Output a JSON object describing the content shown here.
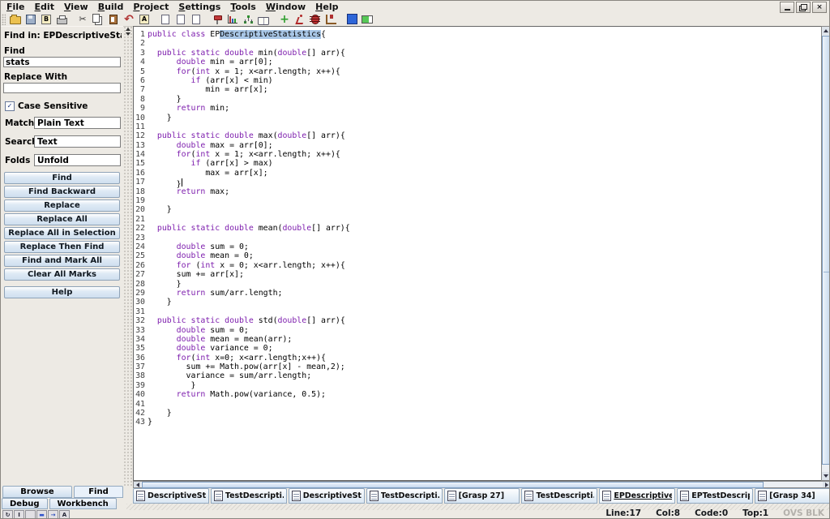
{
  "menubar": {
    "items": [
      "File",
      "Edit",
      "View",
      "Build",
      "Project",
      "Settings",
      "Tools",
      "Window",
      "Help"
    ]
  },
  "window_controls": {
    "minimize": "minimize",
    "restore": "restore",
    "close": "close",
    "close_glyph": "×"
  },
  "toolbar": {
    "icons": [
      {
        "name": "open-file-icon",
        "shape": "folder"
      },
      {
        "name": "save-icon",
        "shape": "floppy"
      },
      {
        "name": "bytecode-icon",
        "glyph": "B",
        "boxed": true
      },
      {
        "name": "print-icon",
        "shape": "printer"
      },
      {
        "name": "cut-icon",
        "glyph": "✂",
        "color": "#333333",
        "gap": true
      },
      {
        "name": "copy-icon",
        "shape": "copy"
      },
      {
        "name": "paste-icon",
        "shape": "paste"
      },
      {
        "name": "undo-icon",
        "glyph": "↶",
        "color": "#b03434",
        "big": true
      },
      {
        "name": "find-replace-icon",
        "glyph": "A",
        "boxed": true
      },
      {
        "name": "new-view-icon",
        "shape": "page",
        "gap": true
      },
      {
        "name": "new-file-icon",
        "shape": "page"
      },
      {
        "name": "blank-file-icon",
        "shape": "page"
      },
      {
        "name": "pin-window-icon",
        "shape": "pin",
        "gap": true
      },
      {
        "name": "statistics-icon",
        "shape": "chart"
      },
      {
        "name": "hierarchy-icon",
        "shape": "tree"
      },
      {
        "name": "documentation-icon",
        "shape": "book"
      },
      {
        "name": "compile-icon",
        "glyph": "+",
        "color": "#2f9e2f",
        "big": true,
        "gap": true
      },
      {
        "name": "run-icon",
        "shape": "runner"
      },
      {
        "name": "debug-icon",
        "shape": "bug"
      },
      {
        "name": "workbench-icon",
        "shape": "bench"
      },
      {
        "name": "csd-window-icon",
        "shape": "bluesq",
        "gap": true
      },
      {
        "name": "progress-icon",
        "shape": "greenbar"
      }
    ]
  },
  "find_panel": {
    "header": "Find in: EPDescriptiveStatistic",
    "find_label": "Find",
    "find_value": "stats",
    "replace_label": "Replace With",
    "replace_value": "",
    "case_sensitive_label": "Case Sensitive",
    "case_sensitive_checked": true,
    "check_glyph": "✓",
    "match_label": "Match",
    "match_value": "Plain Text",
    "search_label": "Search",
    "search_value": "Text",
    "folds_label": "Folds",
    "folds_value": "Unfold",
    "buttons": [
      "Find",
      "Find Backward",
      "Replace",
      "Replace All",
      "Replace All in Selection",
      "Replace Then Find",
      "Find and Mark All",
      "Clear All Marks"
    ],
    "help_button": "Help"
  },
  "editor": {
    "lines": [
      {
        "n": 1,
        "s": [
          [
            "k",
            "public class "
          ],
          [
            "p",
            "EP"
          ],
          [
            "sel",
            "DescriptiveStatistics"
          ],
          [
            "p",
            "{"
          ]
        ]
      },
      {
        "n": 2,
        "s": []
      },
      {
        "n": 3,
        "s": [
          [
            "p",
            "  "
          ],
          [
            "k",
            "public static double"
          ],
          [
            "p",
            " min("
          ],
          [
            "k",
            "double"
          ],
          [
            "p",
            "[] arr){"
          ]
        ]
      },
      {
        "n": 4,
        "s": [
          [
            "p",
            "      "
          ],
          [
            "k",
            "double"
          ],
          [
            "p",
            " min = arr[0];"
          ]
        ]
      },
      {
        "n": 5,
        "s": [
          [
            "p",
            "      "
          ],
          [
            "k",
            "for"
          ],
          [
            "p",
            "("
          ],
          [
            "k",
            "int"
          ],
          [
            "p",
            " x = 1; x<arr.length; x++){"
          ]
        ]
      },
      {
        "n": 6,
        "s": [
          [
            "p",
            "         "
          ],
          [
            "k",
            "if"
          ],
          [
            "p",
            " (arr[x] < min)"
          ]
        ]
      },
      {
        "n": 7,
        "s": [
          [
            "p",
            "            min = arr[x];"
          ]
        ]
      },
      {
        "n": 8,
        "s": [
          [
            "p",
            "      }"
          ]
        ]
      },
      {
        "n": 9,
        "s": [
          [
            "p",
            "      "
          ],
          [
            "k",
            "return"
          ],
          [
            "p",
            " min;"
          ]
        ]
      },
      {
        "n": 10,
        "s": [
          [
            "p",
            "    }"
          ]
        ]
      },
      {
        "n": 11,
        "s": []
      },
      {
        "n": 12,
        "s": [
          [
            "p",
            "  "
          ],
          [
            "k",
            "public static double"
          ],
          [
            "p",
            " max("
          ],
          [
            "k",
            "double"
          ],
          [
            "p",
            "[] arr){"
          ]
        ]
      },
      {
        "n": 13,
        "s": [
          [
            "p",
            "      "
          ],
          [
            "k",
            "double"
          ],
          [
            "p",
            " max = arr[0];"
          ]
        ]
      },
      {
        "n": 14,
        "s": [
          [
            "p",
            "      "
          ],
          [
            "k",
            "for"
          ],
          [
            "p",
            "("
          ],
          [
            "k",
            "int"
          ],
          [
            "p",
            " x = 1; x<arr.length; x++){"
          ]
        ]
      },
      {
        "n": 15,
        "s": [
          [
            "p",
            "         "
          ],
          [
            "k",
            "if"
          ],
          [
            "p",
            " (arr[x] > max)"
          ]
        ]
      },
      {
        "n": 16,
        "s": [
          [
            "p",
            "            max = arr[x];"
          ]
        ]
      },
      {
        "n": 17,
        "s": [
          [
            "p",
            "      }"
          ]
        ],
        "caret": true
      },
      {
        "n": 18,
        "s": [
          [
            "p",
            "      "
          ],
          [
            "k",
            "return"
          ],
          [
            "p",
            " max;"
          ]
        ]
      },
      {
        "n": 19,
        "s": []
      },
      {
        "n": 20,
        "s": [
          [
            "p",
            "    }"
          ]
        ]
      },
      {
        "n": 21,
        "s": []
      },
      {
        "n": 22,
        "s": [
          [
            "p",
            "  "
          ],
          [
            "k",
            "public static double"
          ],
          [
            "p",
            " mean("
          ],
          [
            "k",
            "double"
          ],
          [
            "p",
            "[] arr){"
          ]
        ]
      },
      {
        "n": 23,
        "s": []
      },
      {
        "n": 24,
        "s": [
          [
            "p",
            "      "
          ],
          [
            "k",
            "double"
          ],
          [
            "p",
            " sum = 0;"
          ]
        ]
      },
      {
        "n": 25,
        "s": [
          [
            "p",
            "      "
          ],
          [
            "k",
            "double"
          ],
          [
            "p",
            " mean = 0;"
          ]
        ]
      },
      {
        "n": 26,
        "s": [
          [
            "p",
            "      "
          ],
          [
            "k",
            "for"
          ],
          [
            "p",
            " ("
          ],
          [
            "k",
            "int"
          ],
          [
            "p",
            " x = 0; x<arr.length; x++){"
          ]
        ]
      },
      {
        "n": 27,
        "s": [
          [
            "p",
            "      sum += arr[x];"
          ]
        ]
      },
      {
        "n": 28,
        "s": [
          [
            "p",
            "      }"
          ]
        ]
      },
      {
        "n": 29,
        "s": [
          [
            "p",
            "      "
          ],
          [
            "k",
            "return"
          ],
          [
            "p",
            " sum/arr.length;"
          ]
        ]
      },
      {
        "n": 30,
        "s": [
          [
            "p",
            "    }"
          ]
        ]
      },
      {
        "n": 31,
        "s": []
      },
      {
        "n": 32,
        "s": [
          [
            "p",
            "  "
          ],
          [
            "k",
            "public static double"
          ],
          [
            "p",
            " std("
          ],
          [
            "k",
            "double"
          ],
          [
            "p",
            "[] arr){"
          ]
        ]
      },
      {
        "n": 33,
        "s": [
          [
            "p",
            "      "
          ],
          [
            "k",
            "double"
          ],
          [
            "p",
            " sum = 0;"
          ]
        ]
      },
      {
        "n": 34,
        "s": [
          [
            "p",
            "      "
          ],
          [
            "k",
            "double"
          ],
          [
            "p",
            " mean = mean(arr);"
          ]
        ]
      },
      {
        "n": 35,
        "s": [
          [
            "p",
            "      "
          ],
          [
            "k",
            "double"
          ],
          [
            "p",
            " variance = 0;"
          ]
        ]
      },
      {
        "n": 36,
        "s": [
          [
            "p",
            "      "
          ],
          [
            "k",
            "for"
          ],
          [
            "p",
            "("
          ],
          [
            "k",
            "int"
          ],
          [
            "p",
            " x=0; x<arr.length;x++){"
          ]
        ]
      },
      {
        "n": 37,
        "s": [
          [
            "p",
            "        sum += Math.pow(arr[x] - mean,2);"
          ]
        ]
      },
      {
        "n": 38,
        "s": [
          [
            "p",
            "        variance = sum/arr.length;"
          ]
        ]
      },
      {
        "n": 39,
        "s": [
          [
            "p",
            "         }"
          ]
        ]
      },
      {
        "n": 40,
        "s": [
          [
            "p",
            "      "
          ],
          [
            "k",
            "return"
          ],
          [
            "p",
            " Math.pow(variance, 0.5);"
          ]
        ]
      },
      {
        "n": 41,
        "s": []
      },
      {
        "n": 42,
        "s": [
          [
            "p",
            "    }"
          ]
        ]
      },
      {
        "n": 43,
        "s": [
          [
            "p",
            "}"
          ]
        ]
      }
    ],
    "colors": {
      "keyword": "#7e1fae",
      "selection": "#a9c7e7",
      "text": "#000000",
      "background": "#ffffff"
    }
  },
  "file_tabs": [
    {
      "label": "DescriptiveSta...",
      "active": false
    },
    {
      "label": "TestDescripti...",
      "active": false
    },
    {
      "label": "DescriptiveSta...",
      "active": false
    },
    {
      "label": "TestDescripti...",
      "active": false
    },
    {
      "label": "[Grasp 27]",
      "active": false
    },
    {
      "label": "TestDescripti...",
      "active": false
    },
    {
      "label": "EPDescriptive...",
      "active": true
    },
    {
      "label": "EPTestDescrip...",
      "active": false
    },
    {
      "label": "[Grasp 34]",
      "active": false
    }
  ],
  "bottom_left": {
    "view_tabs": [
      {
        "label": "Browse",
        "active": false
      },
      {
        "label": "Find",
        "active": true
      }
    ],
    "tool_tabs": [
      {
        "label": "Debug",
        "active": false
      },
      {
        "label": "Workbench",
        "active": false
      }
    ],
    "icons": [
      {
        "name": "refresh-icon",
        "glyph": "↻"
      },
      {
        "name": "insert-mode-icon",
        "glyph": "I"
      },
      {
        "name": "spacer-icon",
        "glyph": ""
      },
      {
        "name": "split-window-icon",
        "glyph": "▬",
        "color": "#3355cc"
      },
      {
        "name": "goto-icon",
        "glyph": "→",
        "color": "#2244bb"
      },
      {
        "name": "font-icon",
        "glyph": "A"
      }
    ]
  },
  "statusbar": {
    "items": [
      "Line:17",
      "Col:8",
      "Code:0",
      "Top:1"
    ],
    "mode": "OVS BLK"
  }
}
